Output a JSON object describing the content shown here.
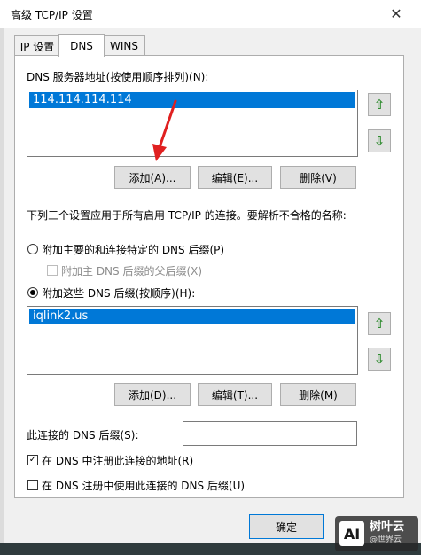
{
  "window": {
    "title": "高级 TCP/IP 设置"
  },
  "tabs": [
    {
      "label": "IP 设置",
      "active": false
    },
    {
      "label": "DNS",
      "active": true
    },
    {
      "label": "WINS",
      "active": false
    }
  ],
  "dns_servers": {
    "label": "DNS 服务器地址(按使用顺序排列)(N):",
    "items": [
      "114.114.114.114"
    ],
    "add_label": "添加(A)...",
    "edit_label": "编辑(E)...",
    "delete_label": "删除(V)"
  },
  "description": "下列三个设置应用于所有启用 TCP/IP 的连接。要解析不合格的名称:",
  "options": {
    "primary_label": "附加主要的和连接特定的 DNS 后缀(P)",
    "parent_label": "附加主 DNS 后缀的父后缀(X)",
    "these_label": "附加这些 DNS 后缀(按顺序)(H):",
    "selected": "these"
  },
  "suffixes": {
    "items": [
      "iqlink2.us"
    ],
    "add_label": "添加(D)...",
    "edit_label": "编辑(T)...",
    "delete_label": "删除(M)"
  },
  "connection_suffix": {
    "label": "此连接的 DNS 后缀(S):",
    "value": ""
  },
  "register": {
    "address_label": "在 DNS 中注册此连接的地址(R)",
    "address_checked": true,
    "suffix_label": "在 DNS 注册中使用此连接的 DNS 后缀(U)",
    "suffix_checked": false
  },
  "footer": {
    "ok_label": "确定"
  },
  "watermark": {
    "logo": "AI",
    "brand": "树叶云",
    "sub": "@世界云"
  },
  "colors": {
    "selection": "#0078d7",
    "arrow": "#2e8b2e",
    "annotation": "#e02020"
  },
  "icons": [
    "close-icon",
    "up-arrow-icon",
    "down-arrow-icon",
    "checkmark-icon"
  ]
}
